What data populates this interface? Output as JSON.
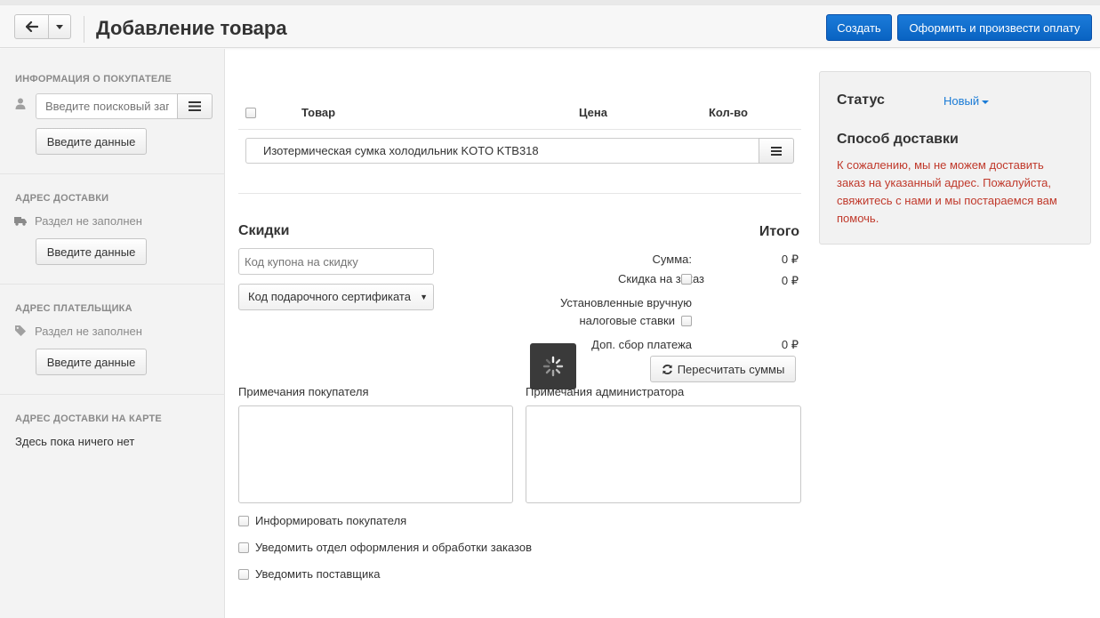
{
  "header": {
    "title": "Добавление товара",
    "create_label": "Создать",
    "pay_label": "Оформить и произвести оплату"
  },
  "sidebar": {
    "buyer": {
      "heading": "Информация о покупателе",
      "search_placeholder": "Введите поисковый запрос",
      "button": "Введите данные"
    },
    "delivery_address": {
      "heading": "Адрес доставки",
      "status": "Раздел не заполнен",
      "button": "Введите данные"
    },
    "payer_address": {
      "heading": "Адрес плательщика",
      "status": "Раздел не заполнен",
      "button": "Введите данные"
    },
    "map": {
      "heading": "Адрес доставки на карте",
      "empty": "Здесь пока ничего нет"
    }
  },
  "products": {
    "columns": [
      "Товар",
      "Цена",
      "Кол-во"
    ],
    "item_name": "Изотермическая сумка холодильник KOTO KTB318"
  },
  "discounts": {
    "heading": "Скидки",
    "coupon_placeholder": "Код купона на скидку",
    "certificate_selected": "Код подарочного сертификата"
  },
  "totals": {
    "heading": "Итого",
    "sum_label": "Сумма:",
    "sum_value": "0 ₽",
    "discount_label": "Скидка на заказ",
    "discount_value": "0 ₽",
    "tax_label_line1": "Установленные вручную",
    "tax_label_line2": "налоговые ставки",
    "fee_label": "Доп. сбор платежа",
    "fee_value": "0 ₽",
    "recalc_button": "Пересчитать суммы"
  },
  "notes": {
    "buyer_label": "Примечания покупателя",
    "admin_label": "Примечания администратора"
  },
  "notifications": {
    "inform_buyer": "Информировать покупателя",
    "notify_department": "Уведомить отдел оформления и обработки заказов",
    "notify_supplier": "Уведомить поставщика"
  },
  "status_panel": {
    "status_heading": "Статус",
    "status_value": "Новый",
    "delivery_heading": "Способ доставки",
    "delivery_error": "К сожалению, мы не можем доставить заказ на указанный адрес. Пожалуйста, свяжитесь с нами и мы постараемся вам помочь.",
    "error_color": "#c0392b",
    "link_color": "#1a7bd6"
  },
  "colors": {
    "primary": "#0963c2",
    "sidebar_bg": "#f3f3f3"
  }
}
